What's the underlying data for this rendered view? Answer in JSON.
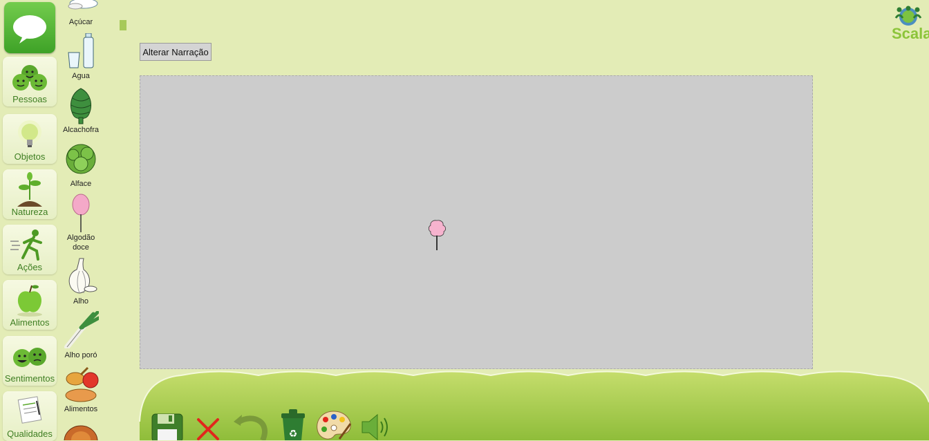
{
  "sidebar": {
    "categories": [
      {
        "label": "Pessoas",
        "icon": "people-faces-icon"
      },
      {
        "label": "Objetos",
        "icon": "lightbulb-icon"
      },
      {
        "label": "Natureza",
        "icon": "plant-icon"
      },
      {
        "label": "Ações",
        "icon": "running-person-icon"
      },
      {
        "label": "Alimentos",
        "icon": "apple-icon"
      },
      {
        "label": "Sentimentos",
        "icon": "feeling-faces-icon"
      },
      {
        "label": "Qualidades",
        "icon": "note-paper-icon"
      }
    ]
  },
  "symbols": [
    {
      "label": "Açúcar",
      "icon": "sugar-icon"
    },
    {
      "label": "Agua",
      "icon": "water-bottle-glass-icon"
    },
    {
      "label": "Alcachofra",
      "icon": "artichoke-icon"
    },
    {
      "label": "Alface",
      "icon": "lettuce-icon"
    },
    {
      "label": "Algodão doce",
      "icon": "cotton-candy-icon"
    },
    {
      "label": "Alho",
      "icon": "garlic-icon"
    },
    {
      "label": "Alho poró",
      "icon": "leek-icon"
    },
    {
      "label": "Alimentos",
      "icon": "food-group-icon"
    }
  ],
  "narration_button": "Alterar Narração",
  "canvas": {
    "placed_symbol": "cotton-candy-icon"
  },
  "logo": {
    "text": "Scala",
    "icon": "scala-people-logo-icon"
  },
  "toolbar": [
    "save-icon",
    "close-icon",
    "undo-icon",
    "trash-icon",
    "palette-icon",
    "speaker-icon"
  ],
  "colors": {
    "background": "#e3ecb6",
    "accent": "#7cc241",
    "canvas": "#cccccc"
  }
}
